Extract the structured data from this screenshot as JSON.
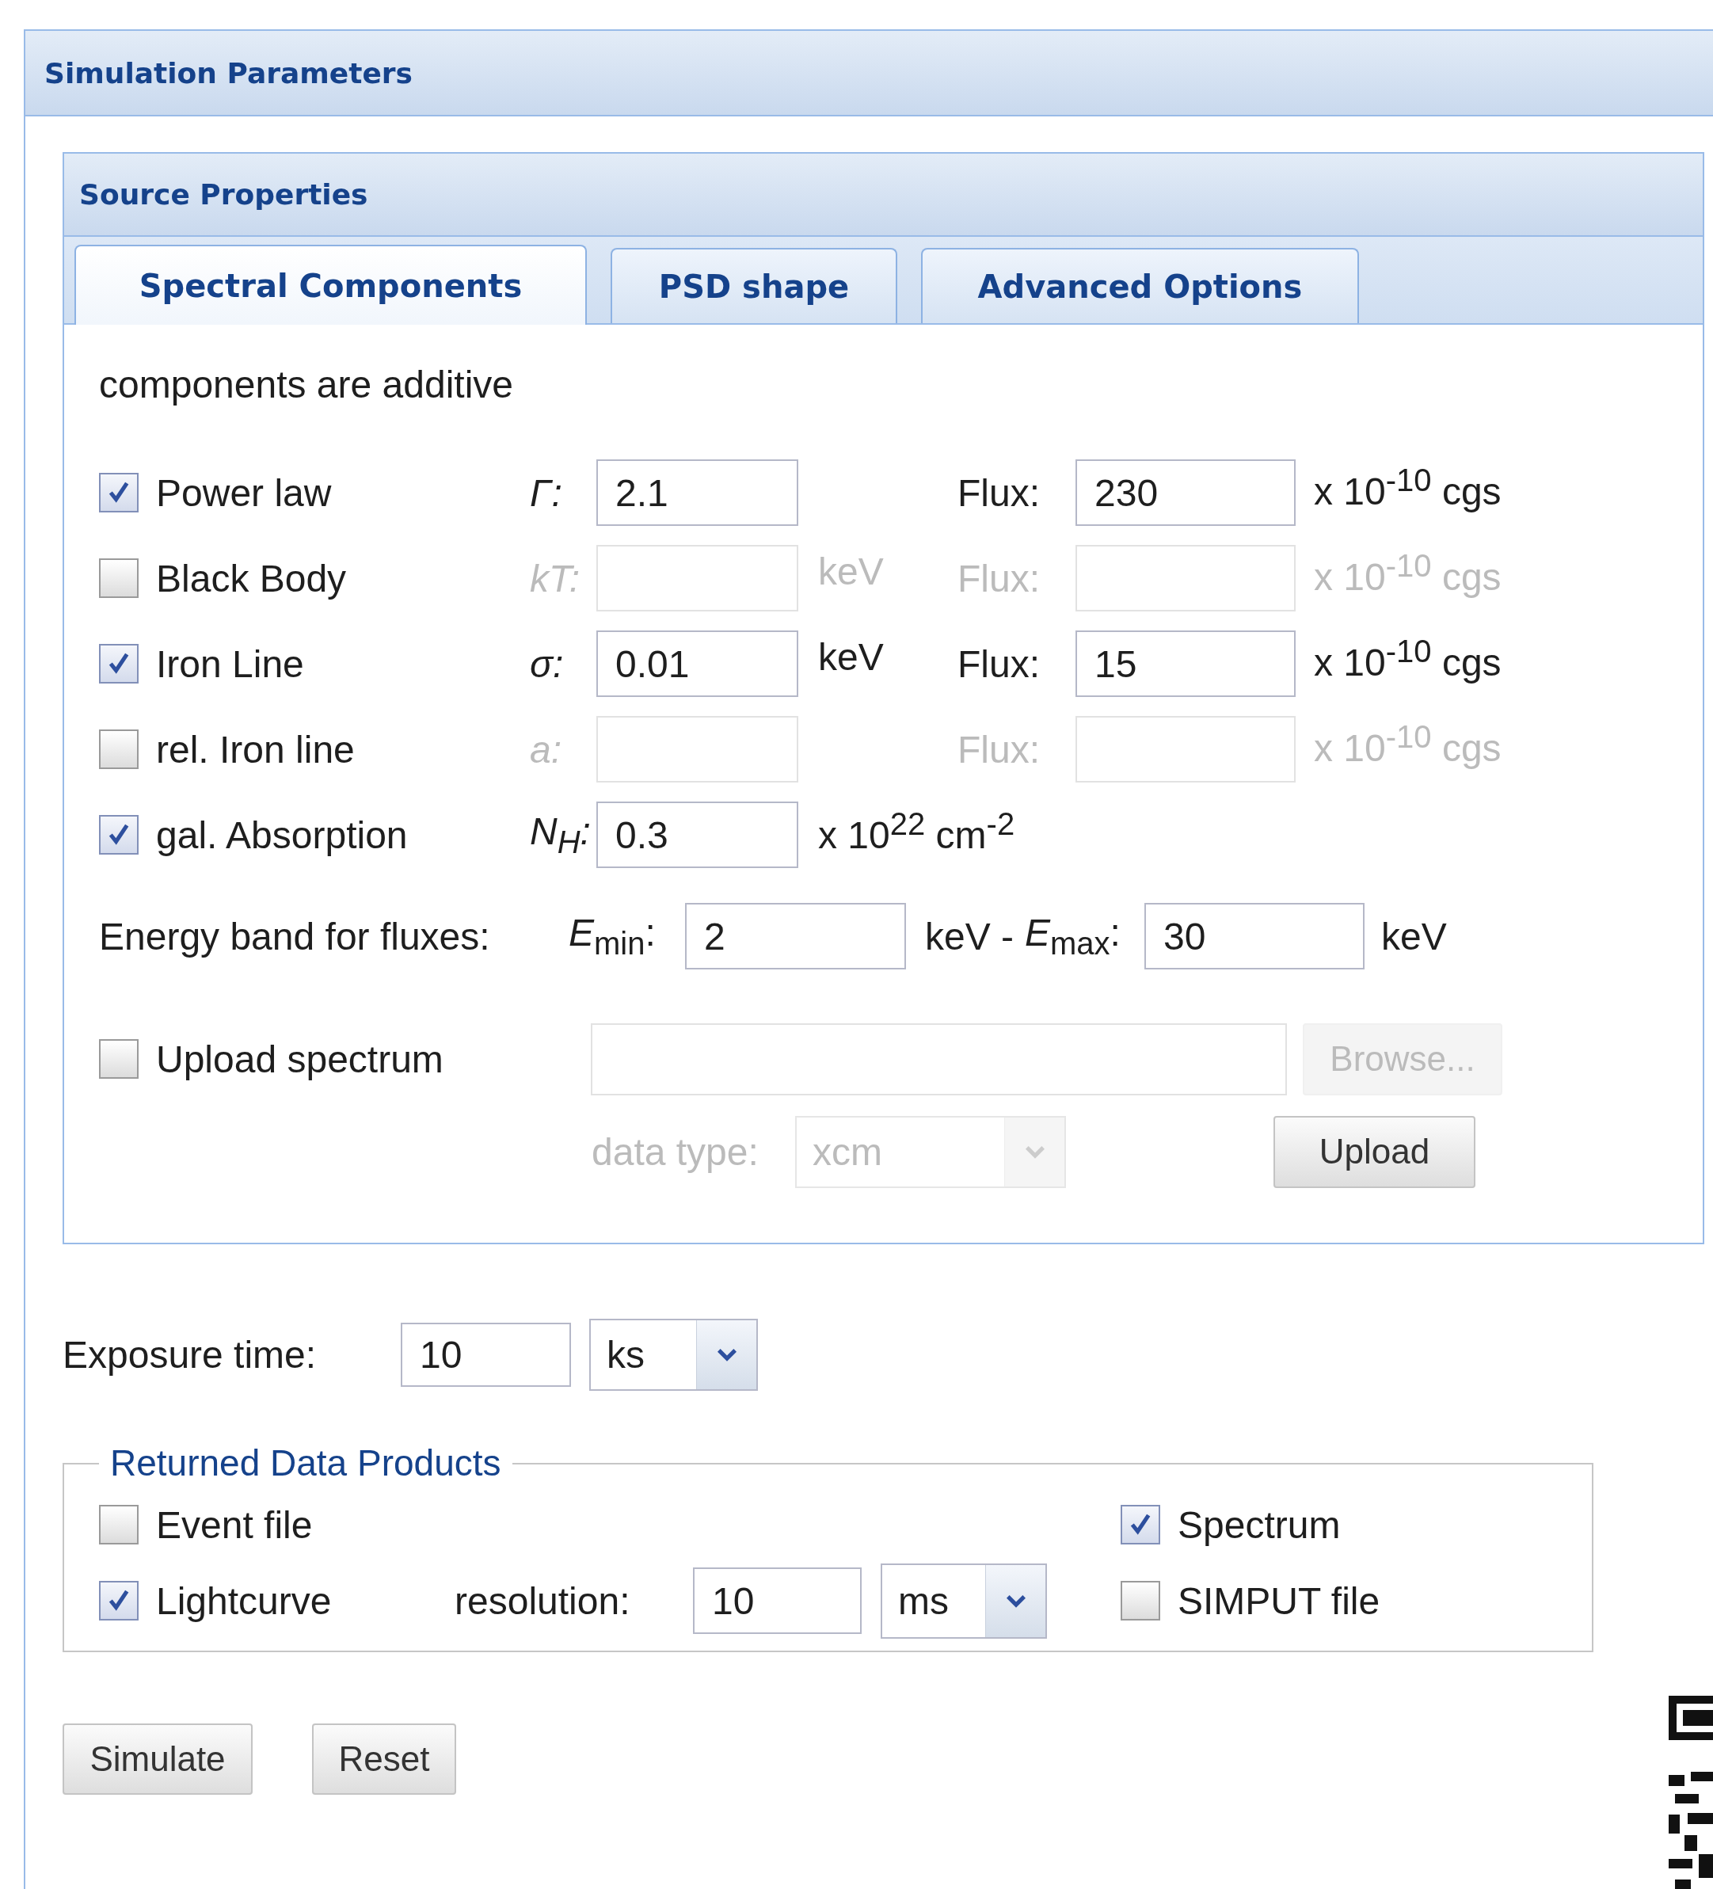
{
  "panel": {
    "title": "Simulation Parameters"
  },
  "source_properties": {
    "title": "Source Properties",
    "tabs": [
      {
        "label": "Spectral Components",
        "selected": true
      },
      {
        "label": "PSD shape",
        "selected": false
      },
      {
        "label": "Advanced Options",
        "selected": false
      }
    ],
    "note": "components are additive",
    "components": [
      {
        "label": "Power law",
        "checked": true,
        "param": "Γ:",
        "value": "2.1",
        "flux_label": "Flux:",
        "flux": "230",
        "flux_unit": "x 10$^{-10}$ cgs"
      },
      {
        "label": "Black Body",
        "checked": false,
        "param": "kT:",
        "unit": "keV",
        "flux_label": "Flux:",
        "flux_unit": "x 10$^{-10}$ cgs"
      },
      {
        "label": "Iron Line",
        "checked": true,
        "param": "σ:",
        "value": "0.01",
        "unit": "keV",
        "flux_label": "Flux:",
        "flux": "15",
        "flux_unit": "x 10$^{-10}$ cgs"
      },
      {
        "label": "rel. Iron line",
        "checked": false,
        "param": "a:",
        "flux_label": "Flux:",
        "flux_unit": "x 10$^{-10}$ cgs"
      },
      {
        "label": "gal. Absorption",
        "checked": true,
        "param": "N$_{H}$:",
        "value": "0.3",
        "unit": "x 10$^{22}$ cm$^{-2}$"
      }
    ],
    "energy_band": {
      "label": "Energy band for fluxes:",
      "min_label": "*E*$_{min}$:",
      "min": "2",
      "min_unit": "keV -",
      "max_label": "*E*$_{max}$:",
      "max": "30",
      "max_unit": "keV"
    },
    "upload": {
      "label": "Upload spectrum",
      "checked": false,
      "browse": "Browse...",
      "data_type_label": "data type:",
      "data_type": "xcm",
      "button": "Upload"
    }
  },
  "exposure": {
    "label": "Exposure time:",
    "value": "10",
    "unit": "ks"
  },
  "data_products": {
    "title": "Returned Data Products",
    "items": [
      {
        "label": "Event file",
        "checked": false
      },
      {
        "label": "Spectrum",
        "checked": true
      },
      {
        "label": "Lightcurve",
        "checked": true,
        "resolution_label": "resolution:",
        "resolution": "10",
        "resolution_unit": "ms"
      },
      {
        "label": "SIMPUT file",
        "checked": false
      }
    ]
  },
  "buttons": [
    "Simulate",
    "Reset"
  ]
}
